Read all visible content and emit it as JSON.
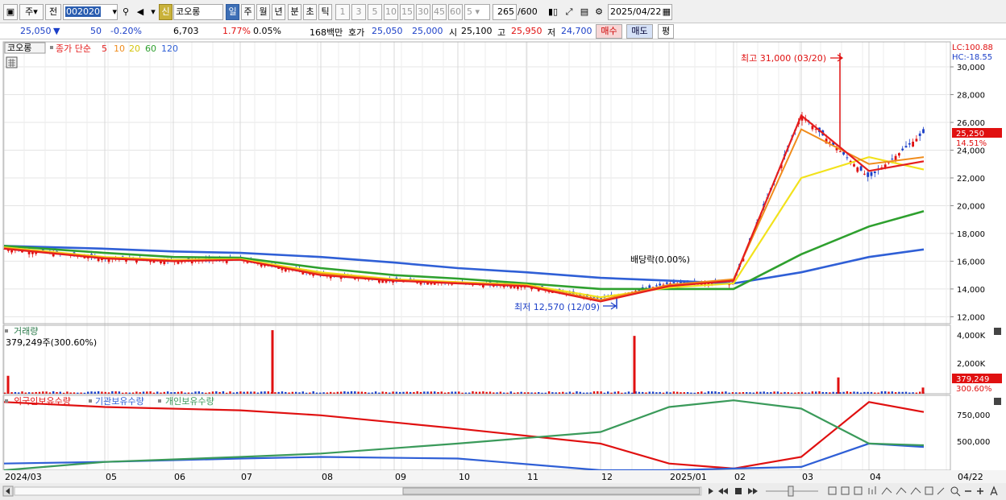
{
  "toolbar": {
    "period_label": "주",
    "prev_label": "전",
    "code": "002020",
    "sin_label": "신",
    "stock_name": "코오롱",
    "periods": [
      "일",
      "주",
      "월",
      "년",
      "분",
      "초",
      "틱"
    ],
    "intervals": [
      "1",
      "3",
      "5",
      "10",
      "15",
      "30",
      "45",
      "60"
    ],
    "custom_interval": "5",
    "count": "265",
    "count_total": "/600",
    "date": "2025/04/22"
  },
  "quote": {
    "price": "25,050",
    "arrow": "▼",
    "change": "50",
    "change_pct": "-0.20%",
    "volume": "6,703",
    "turnover_pct": "1.77%",
    "pct2": "0.05%",
    "amount": "168백만",
    "hoga_label": "호가",
    "ask": "25,050",
    "bid": "25,000",
    "open_label": "시",
    "open": "25,100",
    "high_label": "고",
    "high": "25,950",
    "low_label": "저",
    "low": "24,700",
    "buy_label": "매수",
    "sell_label": "매도",
    "avg_label": "평"
  },
  "price_panel": {
    "name": "코오롱",
    "ma_label": "종가 단순",
    "ma_periods": [
      "5",
      "10",
      "20",
      "60",
      "120"
    ],
    "lc": "LC:100.88",
    "hc": "HC:-18.55",
    "current_price": "25,250",
    "current_pct": "14.51%",
    "high_annotation": "최고 31,000 (03/20)",
    "low_annotation": "최저 12,570 (12/09)",
    "dividend_annotation": "배당락(0.00%)",
    "y_ticks": [
      "30,000",
      "28,000",
      "26,000",
      "24,000",
      "22,000",
      "20,000",
      "18,000",
      "16,000",
      "14,000",
      "12,000"
    ]
  },
  "volume_panel": {
    "title": "거래량",
    "current": "379,249주(300.60%)",
    "badge_value": "379,249",
    "badge_pct": "300.60%",
    "y_ticks": [
      "4,000K",
      "2,000K"
    ]
  },
  "holding_panel": {
    "legend": [
      "외국인보유수량",
      "기관보유수량",
      "개인보유수량"
    ],
    "y_ticks": [
      "750,000",
      "500,000"
    ]
  },
  "x_axis": [
    "2024/03",
    "05",
    "06",
    "07",
    "08",
    "09",
    "10",
    "11",
    "12",
    "2025/01",
    "02",
    "03",
    "04",
    "04/22"
  ],
  "colors": {
    "ma5": "#e51e1e",
    "ma10": "#f08c1c",
    "ma20": "#f2e21c",
    "ma60": "#2ea02e",
    "ma120": "#2f5fd6",
    "up": "#e01010",
    "down": "#1b3fc8",
    "foreign": "#e01010",
    "institution": "#2f5fd6",
    "individual": "#3a9a5a"
  },
  "chart_data": [
    {
      "type": "candlestick",
      "title": "코오롱",
      "x": [
        "2024/03",
        "2024/05",
        "2024/06",
        "2024/07",
        "2024/08",
        "2024/09",
        "2024/10",
        "2024/11",
        "2024/12",
        "2025/01",
        "2025/02",
        "2025/03",
        "2025/04",
        "2025/04/22"
      ],
      "ylim": [
        11500,
        31800
      ],
      "close": [
        16900,
        16200,
        16000,
        16100,
        15000,
        14600,
        14400,
        14200,
        13300,
        14400,
        14500,
        26500,
        22000,
        25250
      ],
      "high_point": {
        "date": "03/20",
        "value": 31000
      },
      "low_point": {
        "date": "12/09",
        "value": 12570
      },
      "series": [
        {
          "name": "5",
          "values": [
            16900,
            16200,
            16000,
            16100,
            15000,
            14600,
            14400,
            14200,
            13100,
            14200,
            14600,
            26500,
            22500,
            23200
          ]
        },
        {
          "name": "10",
          "values": [
            16950,
            16250,
            16050,
            16100,
            15100,
            14650,
            14450,
            14250,
            13200,
            14300,
            14700,
            25500,
            23000,
            23500
          ]
        },
        {
          "name": "20",
          "values": [
            17000,
            16300,
            16100,
            16150,
            15200,
            14700,
            14500,
            14300,
            13400,
            14100,
            14400,
            22000,
            23500,
            22600
          ]
        },
        {
          "name": "60",
          "values": [
            17100,
            16600,
            16300,
            16250,
            15500,
            15000,
            14750,
            14400,
            14000,
            14000,
            14000,
            16500,
            18500,
            19600
          ]
        },
        {
          "name": "120",
          "values": [
            17100,
            16900,
            16700,
            16600,
            16300,
            15900,
            15500,
            15200,
            14800,
            14600,
            14400,
            15200,
            16300,
            16850
          ]
        }
      ]
    },
    {
      "type": "bar",
      "title": "거래량",
      "x": [
        "2024/03",
        "2024/07",
        "2024/12",
        "2025/03",
        "2025/04/22"
      ],
      "values": [
        1100000,
        3900000,
        3550000,
        1000000,
        379249
      ],
      "ylim": [
        0,
        4200000
      ]
    },
    {
      "type": "line",
      "x": [
        "2024/03",
        "2024/05",
        "2024/07",
        "2024/08",
        "2024/10",
        "2024/12",
        "2025/01",
        "2025/02",
        "2025/03",
        "2025/04",
        "2025/04/22"
      ],
      "ylim": [
        400000,
        850000
      ],
      "series": [
        {
          "name": "외국인보유수량",
          "values": [
            810000,
            780000,
            760000,
            730000,
            650000,
            560000,
            440000,
            410000,
            480000,
            810000,
            750000
          ]
        },
        {
          "name": "기관보유수량",
          "values": [
            440000,
            450000,
            470000,
            480000,
            470000,
            400000,
            400000,
            410000,
            420000,
            560000,
            540000
          ]
        },
        {
          "name": "개인보유수량",
          "values": [
            400000,
            450000,
            480000,
            500000,
            560000,
            630000,
            780000,
            820000,
            770000,
            560000,
            550000
          ]
        }
      ]
    }
  ]
}
